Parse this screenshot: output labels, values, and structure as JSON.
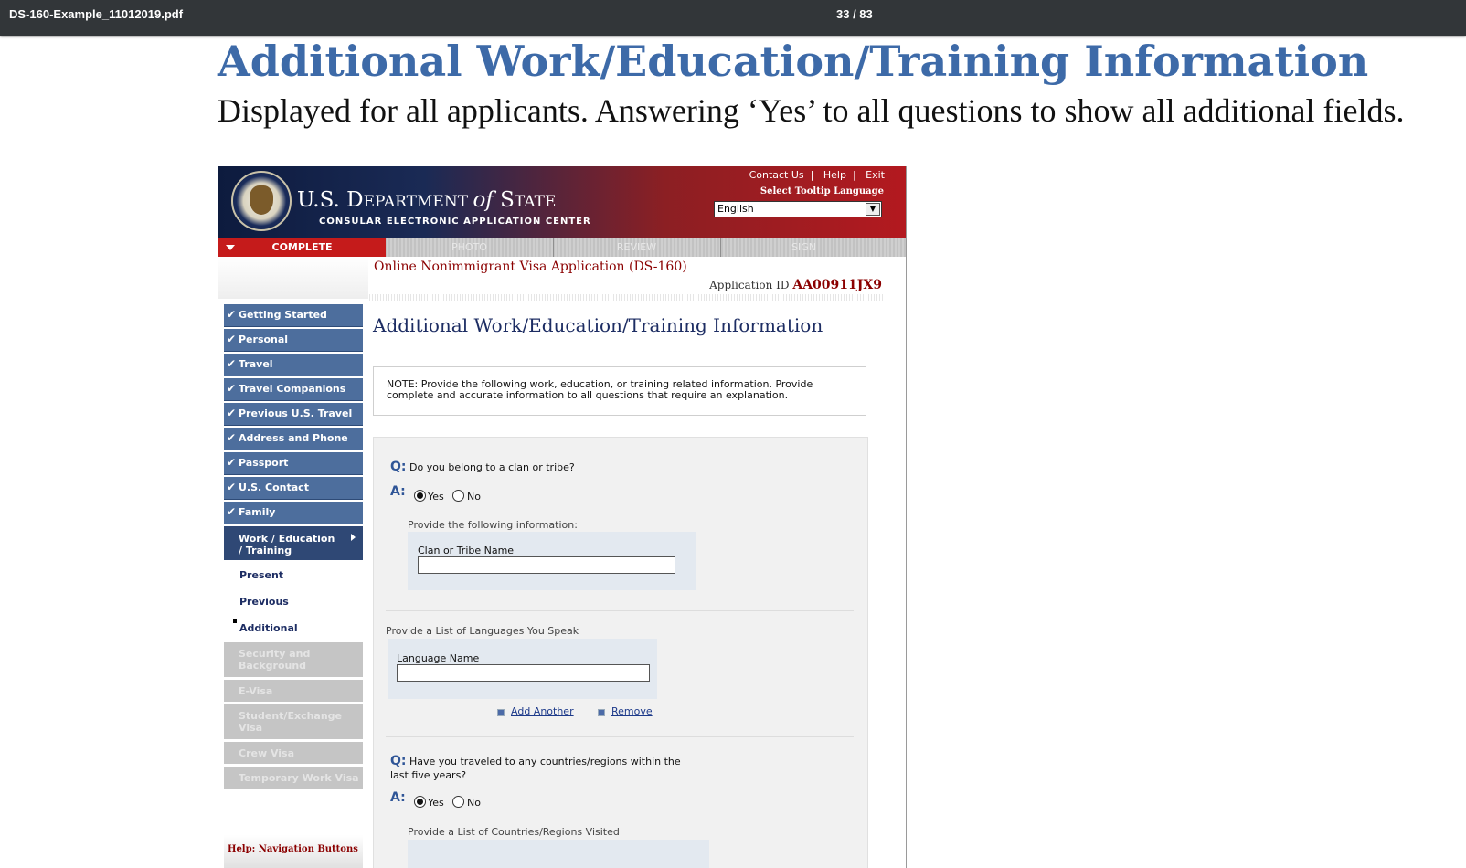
{
  "viewer": {
    "filename": "DS-160-Example_11012019.pdf",
    "page_indicator": "33 / 83"
  },
  "slide": {
    "title": "Additional Work/Education/Training Information",
    "subtitle": "Displayed for all applicants. Answering ‘Yes’ to all questions to show all additional fields."
  },
  "header": {
    "links": [
      "Contact Us",
      "Help",
      "Exit"
    ],
    "dept_us": "U.S. D",
    "dept_rest": "EPARTMENT ",
    "dept_of": "of",
    "dept_s": " S",
    "dept_tate": "TATE",
    "center": "CONSULAR ELECTRONIC APPLICATION CENTER",
    "tooltip_label": "Select Tooltip Language",
    "language": "English"
  },
  "tabs": [
    "COMPLETE",
    "PHOTO",
    "REVIEW",
    "SIGN"
  ],
  "app": {
    "title": "Online Nonimmigrant Visa Application (DS-160)",
    "id_label": "Application ID",
    "id_value": "AA00911JX9"
  },
  "nav": {
    "completed": [
      "Getting Started",
      "Personal",
      "Travel",
      "Travel Companions",
      "Previous U.S. Travel",
      "Address and Phone",
      "Passport",
      "U.S. Contact",
      "Family"
    ],
    "current": "Work / Education / Training",
    "sub": [
      "Present",
      "Previous",
      "Additional"
    ],
    "disabled": [
      "Security and Background",
      "E-Visa",
      "Student/Exchange Visa",
      "Crew Visa",
      "Temporary Work Visa"
    ],
    "help_label": "Help: Navigation Buttons"
  },
  "content": {
    "title": "Additional Work/Education/Training Information",
    "note": "NOTE: Provide the following work, education, or training related information. Provide complete and accurate information to all questions that require an explanation.",
    "q_marker": "Q:",
    "a_marker": "A:",
    "yes": "Yes",
    "no": "No",
    "q1": "Do you belong to a clan or tribe?",
    "q1_sub": "Provide the following information:",
    "q1_field": "Clan or Tribe Name",
    "lang_sub": "Provide a List of Languages You Speak",
    "lang_field": "Language Name",
    "add_another": "Add Another",
    "remove": "Remove",
    "q2": "Have you traveled to any countries/regions within the last five years?",
    "q2_sub": "Provide a List of Countries/Regions Visited"
  }
}
